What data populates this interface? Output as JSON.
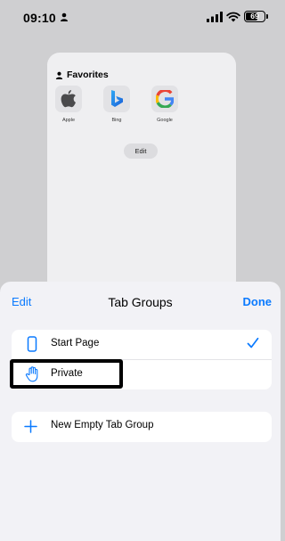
{
  "status_bar": {
    "time": "09:10",
    "battery_level": "69",
    "battery_fraction": 0.69,
    "icons": [
      "person-icon",
      "cellular-signal-icon",
      "wifi-icon",
      "battery-icon"
    ]
  },
  "tab_preview": {
    "favorites_title": "Favorites",
    "favorites": [
      {
        "label": "Apple",
        "icon": "apple-logo-icon"
      },
      {
        "label": "Bing",
        "icon": "bing-logo-icon"
      },
      {
        "label": "Google",
        "icon": "google-logo-icon"
      }
    ],
    "edit_label": "Edit"
  },
  "sheet": {
    "edit_label": "Edit",
    "title": "Tab Groups",
    "done_label": "Done",
    "groups": [
      {
        "label": "Start Page",
        "icon": "phone-icon",
        "selected": true
      },
      {
        "label": "Private",
        "icon": "hand-icon",
        "selected": false
      }
    ],
    "new_group_label": "New Empty Tab Group"
  },
  "colors": {
    "accent": "#0a7aff",
    "background": "#cfcfd1",
    "sheet_background": "#f2f2f6"
  }
}
